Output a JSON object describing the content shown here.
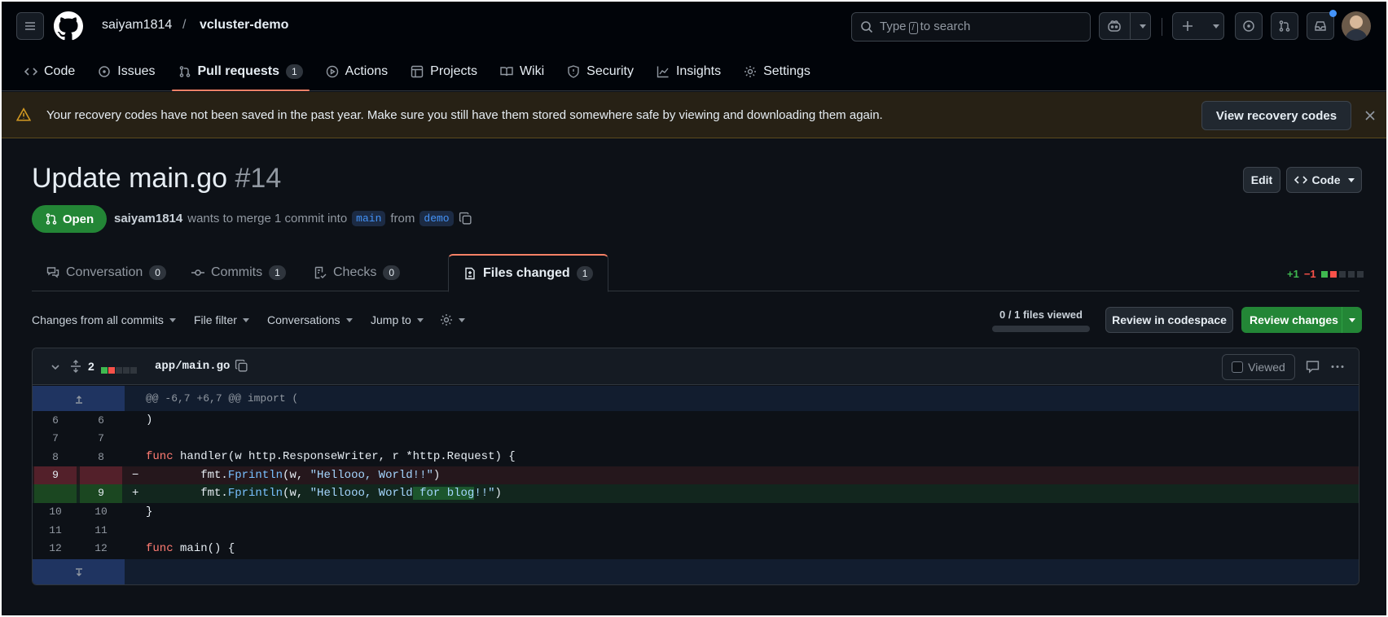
{
  "header": {
    "owner": "saiyam1814",
    "separator": "/",
    "repo": "vcluster-demo",
    "search_prefix": "Type",
    "search_key": "/",
    "search_suffix": "to search"
  },
  "nav": {
    "code": "Code",
    "issues": "Issues",
    "pull_requests": "Pull requests",
    "pull_requests_count": "1",
    "actions": "Actions",
    "projects": "Projects",
    "wiki": "Wiki",
    "security": "Security",
    "insights": "Insights",
    "settings": "Settings"
  },
  "banner": {
    "text": "Your recovery codes have not been saved in the past year. Make sure you still have them stored somewhere safe by viewing and downloading them again.",
    "button": "View recovery codes"
  },
  "pr": {
    "title": "Update main.go",
    "number": "#14",
    "edit": "Edit",
    "code_btn": "Code",
    "state": "Open",
    "author": "saiyam1814",
    "merge_text": "wants to merge 1 commit into",
    "base": "main",
    "from": "from",
    "head": "demo"
  },
  "tabs": [
    {
      "label": "Conversation",
      "count": "0"
    },
    {
      "label": "Commits",
      "count": "1"
    },
    {
      "label": "Checks",
      "count": "0"
    },
    {
      "label": "Files changed",
      "count": "1"
    }
  ],
  "diffstat": {
    "added": "+1",
    "removed": "−1"
  },
  "toolbar": {
    "changes": "Changes from all commits",
    "file_filter": "File filter",
    "conversations": "Conversations",
    "jump_to": "Jump to",
    "files_viewed": "0 / 1 files viewed",
    "codespace": "Review in codespace",
    "review": "Review changes"
  },
  "file": {
    "change_count": "2",
    "path": "app/main.go",
    "viewed": "Viewed",
    "hunk": "@@ -6,7 +6,7 @@ import ("
  },
  "diff": [
    {
      "old": "6",
      "new": "6",
      "text": ")"
    },
    {
      "old": "7",
      "new": "7",
      "text": ""
    },
    {
      "old": "8",
      "new": "8",
      "kw": "func",
      "text": " handler(w http.ResponseWriter, r *http.Request) {"
    },
    {
      "old": "9",
      "sign": "−",
      "pre": "        fmt.",
      "fn": "Fprintln",
      "mid": "(w, ",
      "str": "\"Hellooo, World!!\"",
      "post": ")"
    },
    {
      "new": "9",
      "sign": "+",
      "pre": "        fmt.",
      "fn": "Fprintln",
      "mid": "(w, ",
      "str1": "\"Hellooo, World",
      "hl": " for blog",
      "str2": "!!\"",
      "post": ")"
    },
    {
      "old": "10",
      "new": "10",
      "text": "}"
    },
    {
      "old": "11",
      "new": "11",
      "text": ""
    },
    {
      "old": "12",
      "new": "12",
      "kw": "func",
      "text": " main() {"
    }
  ]
}
